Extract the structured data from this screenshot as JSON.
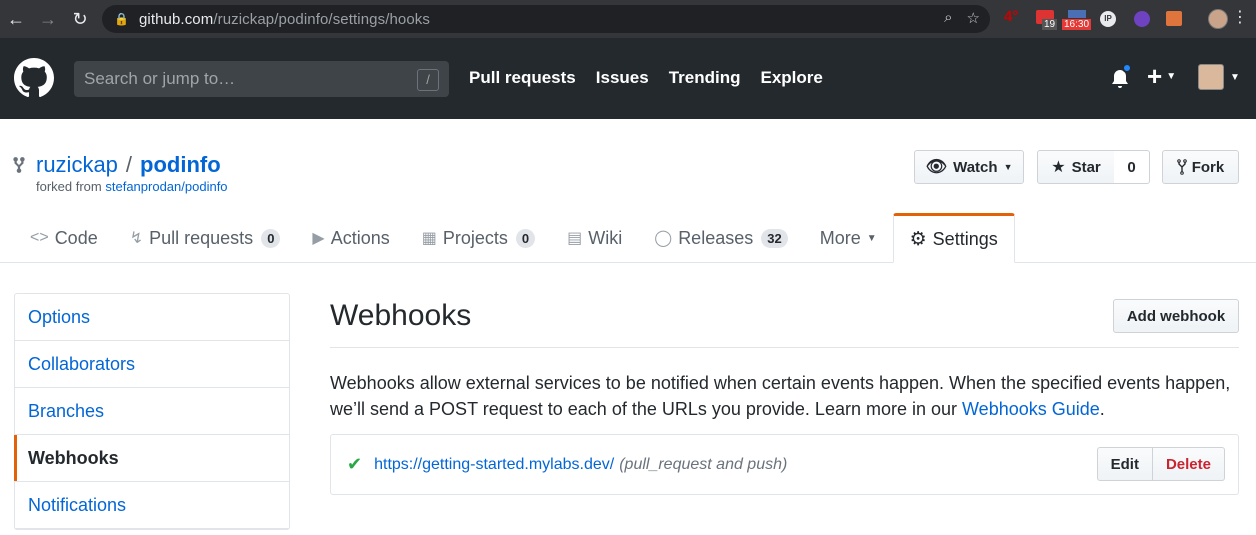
{
  "browser": {
    "url_host": "github.com",
    "url_path": "/ruzickap/podinfo/settings/hooks",
    "ext_badges": [
      "4°",
      "19",
      "16:30",
      "IP"
    ]
  },
  "header": {
    "search_placeholder": "Search or jump to…",
    "search_shortcut": "/",
    "nav": [
      "Pull requests",
      "Issues",
      "Trending",
      "Explore"
    ]
  },
  "repo": {
    "owner": "ruzickap",
    "separator": "/",
    "name": "podinfo",
    "forked_prefix": "forked from",
    "forked_source": "stefanprodan/podinfo",
    "watch_label": "Watch",
    "star_label": "Star",
    "star_count": "0",
    "fork_label": "Fork"
  },
  "tabs": [
    {
      "label": "Code",
      "icon": "code-icon"
    },
    {
      "label": "Pull requests",
      "count": "0",
      "icon": "pull-request-icon"
    },
    {
      "label": "Actions",
      "icon": "play-icon"
    },
    {
      "label": "Projects",
      "count": "0",
      "icon": "project-icon"
    },
    {
      "label": "Wiki",
      "icon": "book-icon"
    },
    {
      "label": "Releases",
      "count": "32",
      "icon": "tag-icon"
    },
    {
      "label": "More",
      "icon": "chevron-down-icon"
    },
    {
      "label": "Settings",
      "icon": "gear-icon"
    }
  ],
  "sidebar": {
    "items": [
      "Options",
      "Collaborators",
      "Branches",
      "Webhooks",
      "Notifications"
    ]
  },
  "main": {
    "title": "Webhooks",
    "add_label": "Add webhook",
    "desc_text": "Webhooks allow external services to be notified when certain events happen. When the specified events happen, we’ll send a POST request to each of the URLs you provide. Learn more in our ",
    "desc_link": "Webhooks Guide",
    "desc_end": ".",
    "hook": {
      "url": "https://getting-started.mylabs.dev/",
      "events": "(pull_request and push)",
      "edit_label": "Edit",
      "delete_label": "Delete"
    }
  },
  "colors": {
    "accent": "#e36209",
    "link": "#0366d6",
    "success": "#28a745",
    "danger": "#cb2431"
  }
}
